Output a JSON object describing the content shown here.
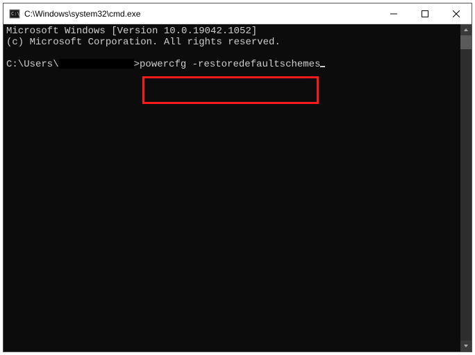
{
  "titlebar": {
    "title": "C:\\Windows\\system32\\cmd.exe"
  },
  "console": {
    "line1": "Microsoft Windows [Version 10.0.19042.1052]",
    "line2": "(c) Microsoft Corporation. All rights reserved.",
    "prompt_prefix": "C:\\Users\\",
    "prompt_suffix": ">",
    "command": "powercfg -restoredefaultschemes"
  },
  "highlight_color": "#ff1a1a"
}
